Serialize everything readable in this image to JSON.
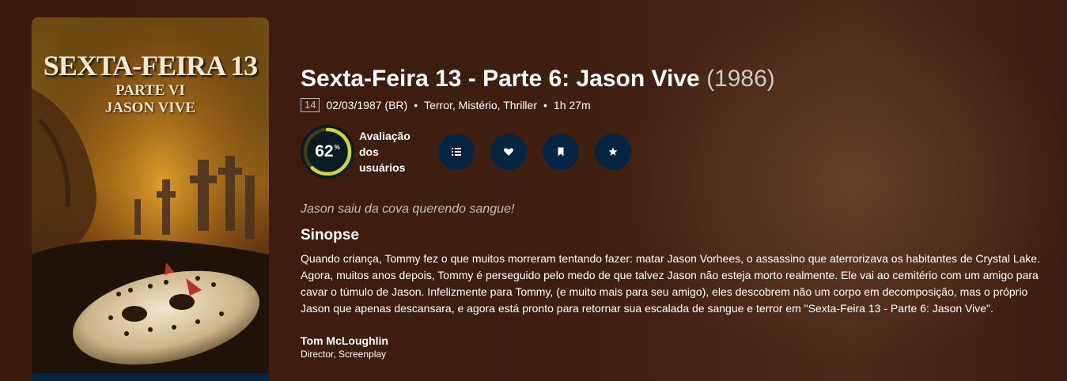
{
  "poster": {
    "title": "SEXTA-FEIRA 13",
    "part": "PARTE VI",
    "subtitle": "JASON VIVE"
  },
  "movie": {
    "title": "Sexta-Feira 13 - Parte 6: Jason Vive",
    "year": "(1986)",
    "certification": "14",
    "release": "02/03/1987 (BR)",
    "genres": "Terror, Mistério, Thriller",
    "runtime": "1h 27m"
  },
  "score": {
    "value": "62",
    "percent_symbol": "%",
    "fraction": 0.62,
    "ring_color": "#d2d531",
    "track_color": "#423d0f",
    "label_line1": "Avaliação",
    "label_line2": "dos",
    "label_line3": "usuários"
  },
  "actions": {
    "list_icon": "list-icon",
    "favorite_icon": "heart-icon",
    "watchlist_icon": "bookmark-icon",
    "rate_icon": "star-icon"
  },
  "tagline": "Jason saiu da cova querendo sangue!",
  "overview": {
    "heading": "Sinopse",
    "text": "Quando criança, Tommy fez o que muitos morreram tentando fazer: matar Jason Vorhees, o assassino que aterrorizava os habitantes de Crystal Lake. Agora, muitos anos depois, Tommy é perseguido pelo medo de que talvez Jason não esteja morto realmente. Ele vai ao cemitério com um amigo para cavar o túmulo de Jason. Infelizmente para Tommy, (e muito mais para seu amigo), eles descobrem não um corpo em decomposição, mas o próprio Jason que apenas descansara, e agora está pronto para retornar sua escalada de sangue e terror em \"Sexta-Feira 13 - Parte 6: Jason Vive\"."
  },
  "crew": [
    {
      "name": "Tom McLoughlin",
      "role": "Director, Screenplay"
    }
  ],
  "colors": {
    "background": "#3d1d0f",
    "button_bg": "#032541"
  }
}
